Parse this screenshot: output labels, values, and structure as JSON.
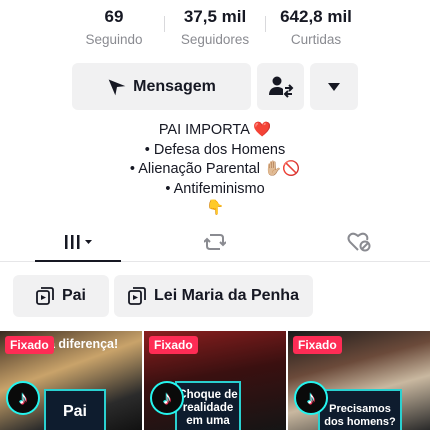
{
  "stats": [
    {
      "value": "69",
      "label": "Seguindo"
    },
    {
      "value": "37,5 mil",
      "label": "Seguidores"
    },
    {
      "value": "642,8 mil",
      "label": "Curtidas"
    }
  ],
  "actions": {
    "message_label": "Mensagem",
    "friend_icon": "person-swap-icon",
    "more_icon": "caret-down-icon"
  },
  "bio": {
    "line1": "PAI IMPORTA ❤️",
    "line2": "• Defesa dos Homens",
    "line3": "• Alienação Parental ✋🏼🚫",
    "line4": "• Antifeminismo",
    "line5": "👇"
  },
  "tabs": [
    {
      "name": "videos",
      "icon": "grid-icon"
    },
    {
      "name": "reposts",
      "icon": "repost-icon"
    },
    {
      "name": "liked",
      "icon": "heart-hidden-icon"
    }
  ],
  "playlists": [
    {
      "label": "Pai"
    },
    {
      "label": "Lei Maria da Penha"
    }
  ],
  "videos": [
    {
      "badge": "Fixado",
      "caption_top": "a diferença!",
      "caption": "Pai"
    },
    {
      "badge": "Fixado",
      "caption": "Choque de realidade em uma"
    },
    {
      "badge": "Fixado",
      "caption": "Precisamos dos homens?"
    }
  ],
  "colors": {
    "accent": "#fe2c55",
    "tile_border": "#2ad0d0",
    "secondary_text": "#8a8b91"
  }
}
